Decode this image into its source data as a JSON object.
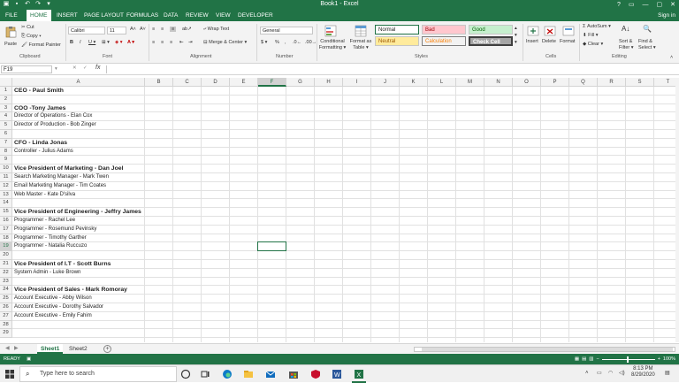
{
  "window": {
    "title": "Book1 - Excel"
  },
  "tabs": [
    "FILE",
    "HOME",
    "INSERT",
    "PAGE LAYOUT",
    "FORMULAS",
    "DATA",
    "REVIEW",
    "VIEW",
    "DEVELOPER"
  ],
  "signin": "Sign in",
  "ribbon": {
    "clipboard": {
      "paste": "Paste",
      "cut": "Cut",
      "copy": "Copy",
      "format_painter": "Format Painter",
      "label": "Clipboard"
    },
    "font": {
      "name": "Calibri",
      "size": "11",
      "label": "Font"
    },
    "alignment": {
      "wrap": "Wrap Text",
      "merge": "Merge & Center",
      "label": "Alignment"
    },
    "number": {
      "format": "General",
      "label": "Number"
    },
    "styles": {
      "cond": "Conditional Formatting",
      "cond_l1": "Conditional",
      "cond_l2": "Formatting",
      "format_as": "Format as",
      "table": "Table",
      "normal": "Normal",
      "bad": "Bad",
      "good": "Good",
      "neutral": "Neutral",
      "calculation": "Calculation",
      "check": "Check Cell",
      "label": "Styles"
    },
    "cells": {
      "insert": "Insert",
      "delete": "Delete",
      "format": "Format",
      "label": "Cells"
    },
    "editing": {
      "autosum": "AutoSum",
      "fill": "Fill",
      "clear": "Clear",
      "sort": "Sort &",
      "filter": "Filter",
      "find": "Find &",
      "select": "Select",
      "label": "Editing"
    }
  },
  "formula_bar": {
    "name_box": "F19",
    "fx": "fx",
    "content": ""
  },
  "columns": [
    "A",
    "B",
    "C",
    "D",
    "E",
    "F",
    "G",
    "H",
    "I",
    "J",
    "K",
    "L",
    "M",
    "N",
    "O",
    "P",
    "Q",
    "R",
    "S",
    "T"
  ],
  "selected_column": "F",
  "selected_row": "19",
  "rows": [
    "1",
    "2",
    "3",
    "4",
    "5",
    "6",
    "7",
    "8",
    "9",
    "10",
    "11",
    "12",
    "13",
    "14",
    "15",
    "16",
    "17",
    "18",
    "19",
    "20",
    "21",
    "22",
    "23",
    "24",
    "25",
    "26",
    "27",
    "28",
    "29"
  ],
  "cells": [
    {
      "row": 1,
      "text": "CEO - Paul Smith",
      "bold": true
    },
    {
      "row": 3,
      "text": "COO -Tony James",
      "bold": true
    },
    {
      "row": 4,
      "text": "Director of Operations - Elan Cox",
      "bold": false
    },
    {
      "row": 5,
      "text": "Director of Production - Bob Zinger",
      "bold": false
    },
    {
      "row": 7,
      "text": "CFO - Linda Jonas",
      "bold": true
    },
    {
      "row": 8,
      "text": "Controller - Julius Adams",
      "bold": false
    },
    {
      "row": 10,
      "text": "Vice President of Marketing - Dan Joel",
      "bold": true
    },
    {
      "row": 11,
      "text": "Search Marketing Manager - Mark Twen",
      "bold": false
    },
    {
      "row": 12,
      "text": "Email Marketing Manager - Tim Coates",
      "bold": false
    },
    {
      "row": 13,
      "text": "Web Master - Kate D'silva",
      "bold": false
    },
    {
      "row": 15,
      "text": "Vice President of Engineering - Jeffry James",
      "bold": true
    },
    {
      "row": 16,
      "text": "Programmer - Rachel Lee",
      "bold": false
    },
    {
      "row": 17,
      "text": "Programmer - Rosemund Pevinsky",
      "bold": false
    },
    {
      "row": 18,
      "text": "Programmer - Timothy Garther",
      "bold": false
    },
    {
      "row": 19,
      "text": "Programmer - Natalia Ruccuzo",
      "bold": false
    },
    {
      "row": 21,
      "text": "Vice President of I.T - Scott Burns",
      "bold": true
    },
    {
      "row": 22,
      "text": "System Admin - Luke Brown",
      "bold": false
    },
    {
      "row": 24,
      "text": "Vice President of Sales - Mark Romoray",
      "bold": true
    },
    {
      "row": 25,
      "text": "Account Executive - Abby Wilson",
      "bold": false
    },
    {
      "row": 26,
      "text": "Account Executive - Dorothy Salvador",
      "bold": false
    },
    {
      "row": 27,
      "text": "Account Executive - Emily Fahim",
      "bold": false
    }
  ],
  "sheets": [
    "Sheet1",
    "Sheet2"
  ],
  "active_sheet": "Sheet1",
  "status": {
    "ready": "READY",
    "zoom": "100%"
  },
  "taskbar": {
    "search_placeholder": "Type here to search",
    "time": "8:13 PM",
    "date": "8/29/2020"
  },
  "colors": {
    "excel_green": "#217346",
    "bad_bg": "#ffc7ce",
    "good_bg": "#c6efce",
    "neutral_bg": "#ffeb9c",
    "check_bg": "#a5a5a5"
  }
}
